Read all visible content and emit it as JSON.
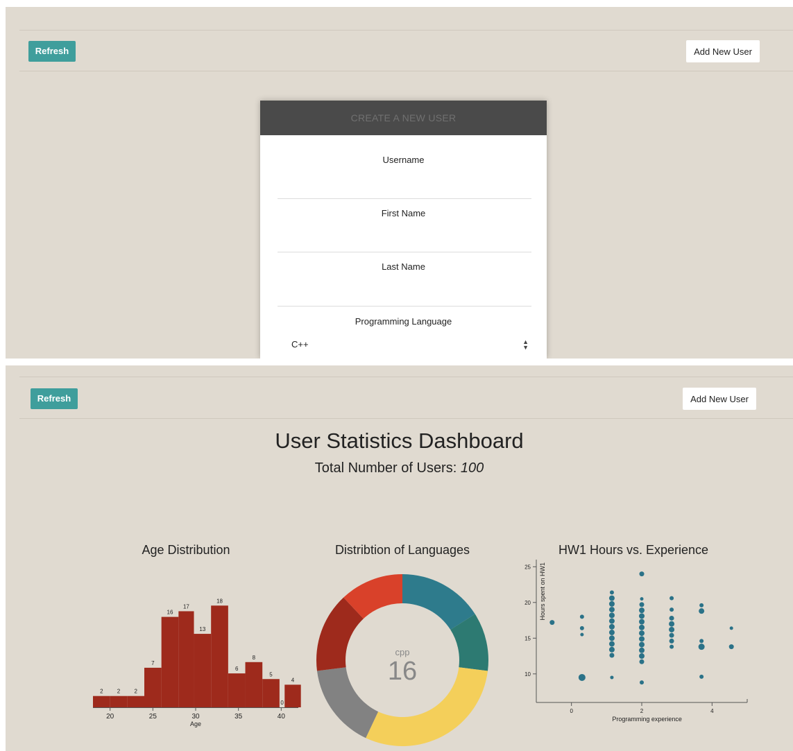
{
  "top_screen": {
    "refresh_label": "Refresh",
    "add_user_label": "Add New User",
    "modal": {
      "title": "CREATE A NEW USER",
      "fields": {
        "username_label": "Username",
        "first_name_label": "First Name",
        "last_name_label": "Last Name",
        "language_label": "Programming Language",
        "language_value": "C++"
      }
    }
  },
  "bottom_screen": {
    "refresh_label": "Refresh",
    "add_user_label": "Add New User",
    "title": "User Statistics Dashboard",
    "total_label": "Total Number of Users:",
    "total_value": "100"
  },
  "colors": {
    "panel_bg": "#e0dad0",
    "accent": "#3f9e9c",
    "bar": "#9e2a1c",
    "scatter": "#2b7288",
    "modal_header": "#4a4a4a"
  },
  "chart_data": [
    {
      "type": "bar",
      "title": "Age Distribution",
      "xlabel": "Age",
      "ylabel": "",
      "bins": [
        [
          18,
          20
        ],
        [
          20,
          22
        ],
        [
          22,
          24
        ],
        [
          24,
          26
        ],
        [
          26,
          28
        ],
        [
          28,
          30
        ],
        [
          30,
          32
        ],
        [
          32,
          34
        ],
        [
          34,
          36
        ],
        [
          36,
          38
        ],
        [
          38,
          40
        ],
        [
          40,
          42
        ]
      ],
      "values": [
        2,
        2,
        2,
        7,
        16,
        17,
        13,
        18,
        6,
        8,
        5,
        0,
        4
      ],
      "xlim": [
        18,
        42
      ],
      "xticks": [
        20,
        25,
        30,
        35,
        40
      ]
    },
    {
      "type": "pie",
      "title": "Distribtion of Languages",
      "center_label": "cpp",
      "center_value": "16",
      "slices": [
        {
          "color": "#2e7b8c",
          "value": 16
        },
        {
          "color": "#2d7a72",
          "value": 11
        },
        {
          "color": "#f4cf5a",
          "value": 30
        },
        {
          "color": "#828282",
          "value": 16
        },
        {
          "color": "#9e2a1c",
          "value": 15
        },
        {
          "color": "#d9412a",
          "value": 12
        }
      ]
    },
    {
      "type": "scatter",
      "title": "HW1 Hours vs. Experience",
      "xlabel": "Programming experience",
      "ylabel": "Hours spent on HW1",
      "xticks": [
        0,
        2,
        4
      ],
      "yticks": [
        10,
        15,
        20,
        25
      ],
      "xlim": [
        -1,
        5
      ],
      "ylim": [
        6,
        26
      ],
      "points": [
        {
          "x": -0.55,
          "y": 17.2,
          "r": 3.5
        },
        {
          "x": 0.3,
          "y": 18.0,
          "r": 3
        },
        {
          "x": 0.3,
          "y": 16.4,
          "r": 3
        },
        {
          "x": 0.3,
          "y": 15.5,
          "r": 2.5
        },
        {
          "x": 0.3,
          "y": 9.5,
          "r": 5
        },
        {
          "x": 1.15,
          "y": 21.4,
          "r": 3
        },
        {
          "x": 1.15,
          "y": 20.6,
          "r": 4
        },
        {
          "x": 1.15,
          "y": 19.8,
          "r": 4
        },
        {
          "x": 1.15,
          "y": 19.0,
          "r": 4
        },
        {
          "x": 1.15,
          "y": 18.2,
          "r": 4
        },
        {
          "x": 1.15,
          "y": 17.4,
          "r": 4
        },
        {
          "x": 1.15,
          "y": 16.6,
          "r": 4
        },
        {
          "x": 1.15,
          "y": 15.8,
          "r": 4
        },
        {
          "x": 1.15,
          "y": 15.0,
          "r": 4
        },
        {
          "x": 1.15,
          "y": 14.2,
          "r": 4
        },
        {
          "x": 1.15,
          "y": 13.4,
          "r": 4
        },
        {
          "x": 1.15,
          "y": 12.6,
          "r": 3.5
        },
        {
          "x": 1.15,
          "y": 9.5,
          "r": 2.5
        },
        {
          "x": 2.0,
          "y": 24.0,
          "r": 3.5
        },
        {
          "x": 2.0,
          "y": 20.5,
          "r": 2.5
        },
        {
          "x": 2.0,
          "y": 19.7,
          "r": 3.5
        },
        {
          "x": 2.0,
          "y": 18.9,
          "r": 4
        },
        {
          "x": 2.0,
          "y": 18.1,
          "r": 4
        },
        {
          "x": 2.0,
          "y": 17.3,
          "r": 4
        },
        {
          "x": 2.0,
          "y": 16.5,
          "r": 4
        },
        {
          "x": 2.0,
          "y": 15.7,
          "r": 4
        },
        {
          "x": 2.0,
          "y": 14.9,
          "r": 4
        },
        {
          "x": 2.0,
          "y": 14.1,
          "r": 4
        },
        {
          "x": 2.0,
          "y": 13.3,
          "r": 4
        },
        {
          "x": 2.0,
          "y": 12.5,
          "r": 4
        },
        {
          "x": 2.0,
          "y": 11.7,
          "r": 3.5
        },
        {
          "x": 2.0,
          "y": 8.8,
          "r": 3
        },
        {
          "x": 2.85,
          "y": 20.6,
          "r": 3
        },
        {
          "x": 2.85,
          "y": 19.0,
          "r": 3
        },
        {
          "x": 2.85,
          "y": 17.8,
          "r": 3.5
        },
        {
          "x": 2.85,
          "y": 17.0,
          "r": 4
        },
        {
          "x": 2.85,
          "y": 16.2,
          "r": 4
        },
        {
          "x": 2.85,
          "y": 15.4,
          "r": 3.5
        },
        {
          "x": 2.85,
          "y": 14.6,
          "r": 3.5
        },
        {
          "x": 2.85,
          "y": 13.8,
          "r": 3
        },
        {
          "x": 3.7,
          "y": 19.6,
          "r": 3
        },
        {
          "x": 3.7,
          "y": 18.8,
          "r": 4
        },
        {
          "x": 3.7,
          "y": 14.6,
          "r": 3
        },
        {
          "x": 3.7,
          "y": 13.8,
          "r": 4.5
        },
        {
          "x": 3.7,
          "y": 9.6,
          "r": 3
        },
        {
          "x": 4.55,
          "y": 16.4,
          "r": 2.5
        },
        {
          "x": 4.55,
          "y": 13.8,
          "r": 3.5
        }
      ]
    }
  ]
}
